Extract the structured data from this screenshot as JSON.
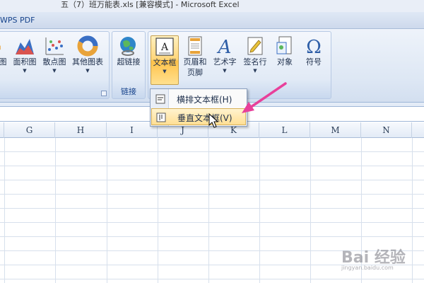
{
  "window": {
    "title": "五（7）班万能表.xls [兼容模式] - Microsoft Excel"
  },
  "tabs": [
    {
      "label": "WPS PDF"
    }
  ],
  "ribbon": {
    "charts_group": {
      "buttons": [
        {
          "label": "图",
          "icon": "chart-partial-icon"
        },
        {
          "label": "面积图",
          "icon": "area-chart-icon"
        },
        {
          "label": "散点图",
          "icon": "scatter-chart-icon"
        },
        {
          "label": "其他图表",
          "icon": "donut-chart-icon"
        }
      ]
    },
    "links_group": {
      "label": "链接",
      "buttons": [
        {
          "label": "超链接",
          "icon": "hyperlink-globe-icon"
        }
      ]
    },
    "text_group": {
      "buttons": [
        {
          "label": "文本框",
          "icon": "textbox-icon"
        },
        {
          "label": "页眉和",
          "label2": "页脚",
          "icon": "header-footer-icon"
        },
        {
          "label": "艺术字",
          "icon": "wordart-icon"
        },
        {
          "label": "签名行",
          "icon": "signature-line-icon"
        },
        {
          "label": "对象",
          "icon": "object-icon"
        },
        {
          "label": "符号",
          "icon": "omega-symbol-icon"
        }
      ]
    }
  },
  "dropdown": {
    "items": [
      {
        "label": "横排文本框(H)",
        "icon": "horizontal-textbox-icon"
      },
      {
        "label": "垂直文本框(V)",
        "icon": "vertical-textbox-icon",
        "highlighted": true
      }
    ]
  },
  "sheet": {
    "columns": [
      "G",
      "H",
      "I",
      "J",
      "K",
      "L",
      "M",
      "N"
    ]
  },
  "watermark": {
    "text": "Bai 经验",
    "url": "jingyan.baidu.com"
  },
  "colors": {
    "ribbon_bg": "#dde7f4",
    "hover": "#ffd67a",
    "annotation_arrow": "#e8409a",
    "header_text": "#15428b"
  }
}
